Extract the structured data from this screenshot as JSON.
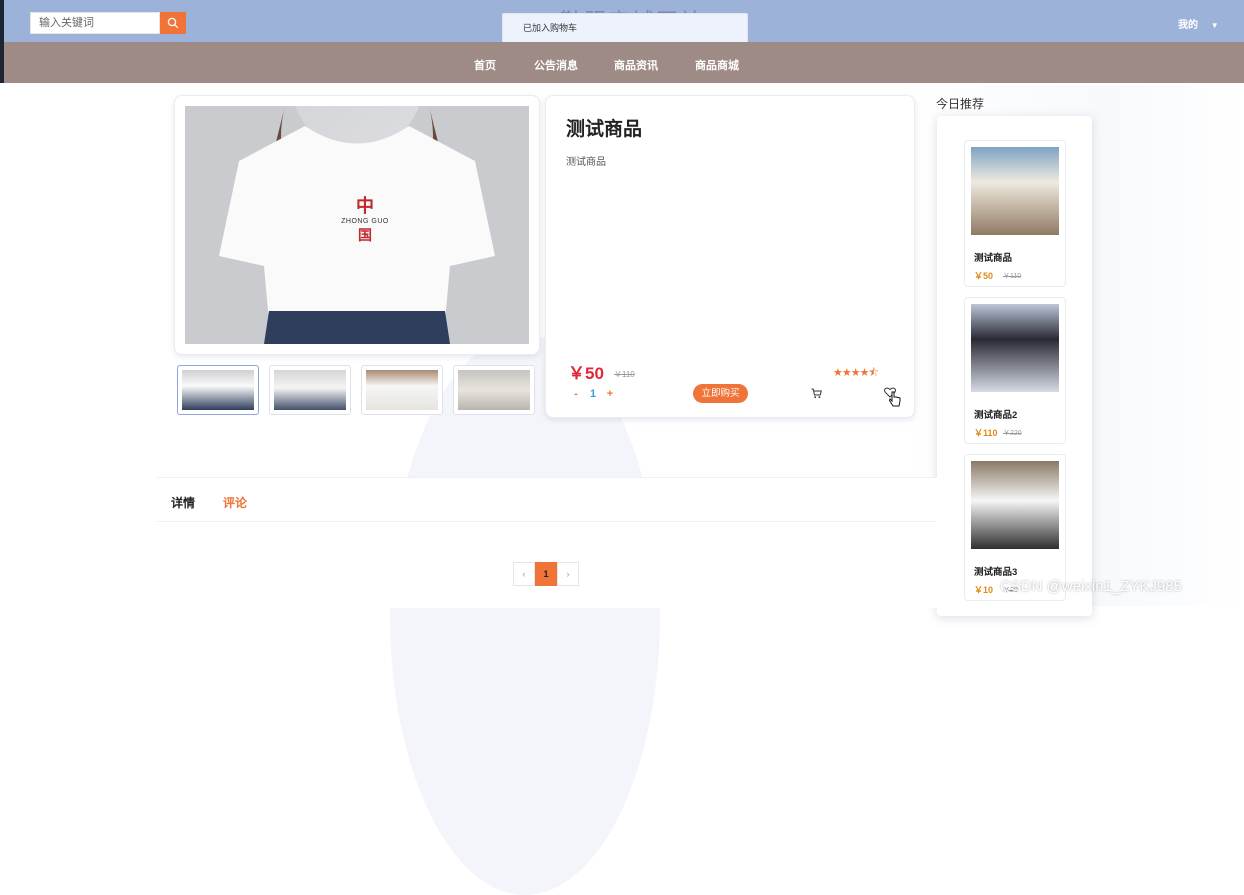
{
  "header": {
    "search_placeholder": "输入关键词",
    "site_title": "鞋服商城网站",
    "toast": "已加入购物车",
    "mine_label": "我的"
  },
  "nav": {
    "items": [
      {
        "label": "首页"
      },
      {
        "label": "公告消息"
      },
      {
        "label": "商品资讯"
      },
      {
        "label": "商品商城"
      }
    ]
  },
  "product": {
    "title": "测试商品",
    "description": "测试商品",
    "price": "￥50",
    "original_price": "￥110",
    "rating": 4.5,
    "stars": "★★★★⯪",
    "quantity": {
      "minus": "-",
      "value": "1",
      "plus": "+"
    },
    "buy_label": "立即购买",
    "image_text": "ZHONG GUO"
  },
  "recommend": {
    "title": "今日推荐",
    "items": [
      {
        "name": "测试商品",
        "price": "￥50",
        "original": "￥110"
      },
      {
        "name": "测试商品2",
        "price": "￥110",
        "original": "￥220"
      },
      {
        "name": "测试商品3",
        "price": "￥10",
        "original": "￥20"
      }
    ]
  },
  "tabs": {
    "detail": "详情",
    "review": "评论"
  },
  "pager": {
    "prev": "‹",
    "current": "1",
    "next": "›"
  },
  "watermark": "CSDN @weixin1_ZYKJ985",
  "colors": {
    "accent": "#f07438",
    "price": "#e0283b",
    "topbar": "#9cb2d8",
    "navbar": "#9e8b85"
  },
  "icons": [
    "search-icon",
    "cart-icon",
    "heart-icon",
    "star-icon",
    "caret-down-icon"
  ]
}
